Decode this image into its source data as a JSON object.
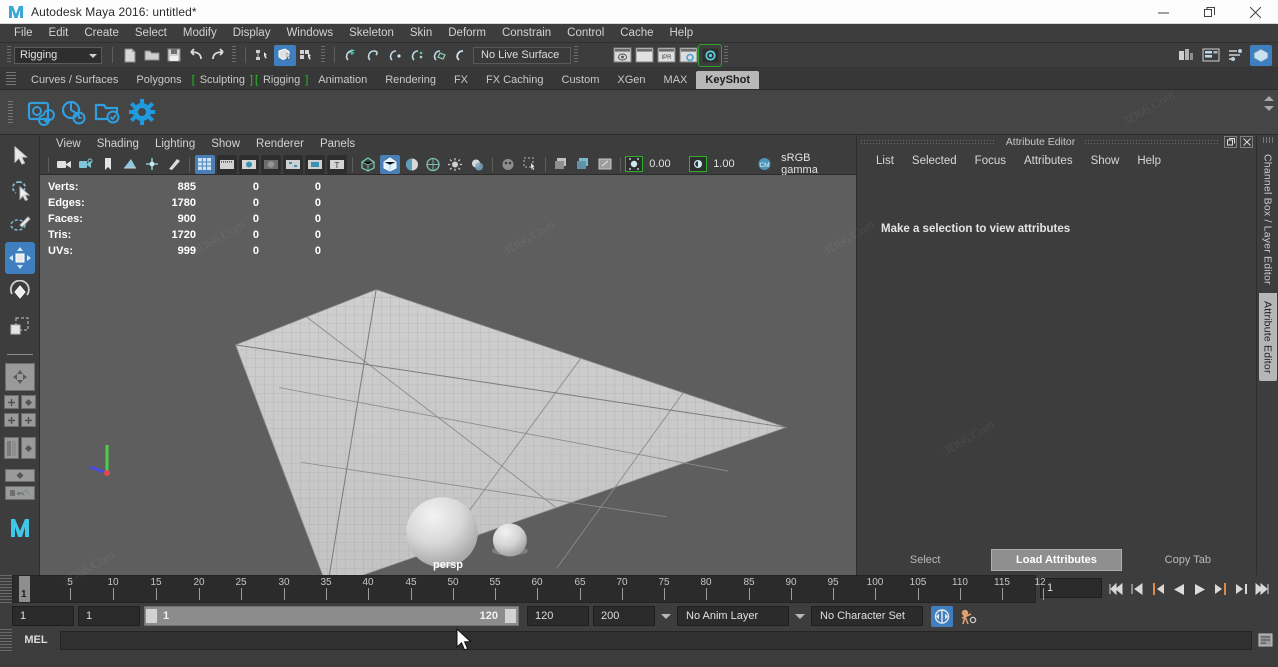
{
  "window": {
    "title": "Autodesk Maya 2016: untitled*",
    "app_icon": "maya-logo-icon",
    "minimize": "minimize-icon",
    "restore": "restore-icon",
    "close": "close-icon"
  },
  "menubar": {
    "items": [
      {
        "label": "File"
      },
      {
        "label": "Edit"
      },
      {
        "label": "Create"
      },
      {
        "label": "Select"
      },
      {
        "label": "Modify"
      },
      {
        "label": "Display"
      },
      {
        "label": "Windows"
      },
      {
        "label": "Skeleton"
      },
      {
        "label": "Skin"
      },
      {
        "label": "Deform"
      },
      {
        "label": "Constrain"
      },
      {
        "label": "Control"
      },
      {
        "label": "Cache"
      },
      {
        "label": "Help"
      }
    ]
  },
  "statusbar": {
    "menuset": "Rigging",
    "menuset_arrow": "chevron-down-icon",
    "live_surface": "No Live Surface",
    "file_icons": [
      "new-scene-icon",
      "open-scene-icon",
      "save-scene-icon",
      "undo-icon",
      "redo-icon"
    ],
    "selmask_icons": [
      "select-by-hierarchy-icon",
      "select-by-object-icon",
      "select-by-component-icon"
    ],
    "snap_icons": [
      "snap-to-grid-icon",
      "snap-to-curve-icon",
      "snap-to-point-icon",
      "snap-to-projected-center-icon",
      "snap-to-view-plane-icon",
      "make-live-icon"
    ],
    "render_icons": [
      "render-current-frame-icon",
      "ipr-render-icon",
      "render-settings-icon",
      "render-view-icon"
    ],
    "right_icons": [
      "show-hide-modeling-toolkit-icon",
      "show-hide-attribute-editor-icon",
      "show-hide-tool-settings-icon",
      "show-hide-channel-box-icon"
    ]
  },
  "shelf": {
    "tabs": [
      {
        "label": "Curves / Surfaces",
        "active": false,
        "bracket": false
      },
      {
        "label": "Polygons",
        "active": false,
        "bracket": false
      },
      {
        "label": "Sculpting",
        "active": false,
        "bracket": true
      },
      {
        "label": "Rigging",
        "active": false,
        "bracket": true
      },
      {
        "label": "Animation",
        "active": false,
        "bracket": false
      },
      {
        "label": "Rendering",
        "active": false,
        "bracket": false
      },
      {
        "label": "FX",
        "active": false,
        "bracket": false
      },
      {
        "label": "FX Caching",
        "active": false,
        "bracket": false
      },
      {
        "label": "Custom",
        "active": false,
        "bracket": false
      },
      {
        "label": "XGen",
        "active": false,
        "bracket": false
      },
      {
        "label": "MAX",
        "active": false,
        "bracket": false
      },
      {
        "label": "KeyShot",
        "active": true,
        "bracket": false
      }
    ],
    "icons": [
      "keyshot-render-icon",
      "keyshot-animation-icon",
      "keyshot-folder-icon",
      "keyshot-settings-icon"
    ],
    "scroll_up": "scroll-up-icon",
    "scroll_down": "scroll-down-icon"
  },
  "toolbox": {
    "tools": [
      {
        "name": "select-tool",
        "selected": false
      },
      {
        "name": "lasso-select-tool",
        "selected": false
      },
      {
        "name": "paint-select-tool",
        "selected": false
      },
      {
        "name": "move-tool",
        "selected": true
      },
      {
        "name": "rotate-tool",
        "selected": false
      },
      {
        "name": "scale-tool",
        "selected": false
      }
    ],
    "layouts": [
      {
        "name": "single-perspective-layout"
      },
      {
        "name": "four-view-layout"
      },
      {
        "name": "persp-outliner-layout"
      },
      {
        "name": "persp-graph-layout"
      }
    ]
  },
  "viewport": {
    "menus": [
      {
        "label": "View"
      },
      {
        "label": "Shading"
      },
      {
        "label": "Lighting"
      },
      {
        "label": "Show"
      },
      {
        "label": "Renderer"
      },
      {
        "label": "Panels"
      }
    ],
    "toolbar_icons": [
      "select-camera-icon",
      "camera-attributes-icon",
      "bookmark-icon",
      "image-plane-icon",
      "two-d-pan-zoom-icon",
      "grease-pencil-icon",
      "grid-toggle-icon",
      "film-gate-icon",
      "resolution-gate-icon",
      "gate-mask-icon",
      "film-origin-icon",
      "safe-action-icon",
      "safe-title-icon",
      "wireframe-icon",
      "smooth-shade-icon",
      "shaded-wireframe-icon",
      "textured-icon",
      "use-all-lights-icon",
      "shadows-icon",
      "screen-space-ao-icon",
      "motion-blur-icon",
      "multisample-icon",
      "xray-icon",
      "xray-joints-icon"
    ],
    "exposure_value": "0.00",
    "gamma_value": "1.00",
    "color_management": "sRGB gamma",
    "camera_label": "persp",
    "hud": {
      "columns": [
        "name",
        "total",
        "selected",
        "other"
      ],
      "rows": [
        {
          "label": "Verts:",
          "c1": "885",
          "c2": "0",
          "c3": "0"
        },
        {
          "label": "Edges:",
          "c1": "1780",
          "c2": "0",
          "c3": "0"
        },
        {
          "label": "Faces:",
          "c1": "900",
          "c2": "0",
          "c3": "0"
        },
        {
          "label": "Tris:",
          "c1": "1720",
          "c2": "0",
          "c3": "0"
        },
        {
          "label": "UVs:",
          "c1": "999",
          "c2": "0",
          "c3": "0"
        }
      ]
    },
    "axis_gizmo": "axis-orientation-gizmo"
  },
  "attribute_editor": {
    "title": "Attribute Editor",
    "float_button": "float-panel-icon",
    "close_button": "close-panel-icon",
    "menus": [
      {
        "label": "List"
      },
      {
        "label": "Selected"
      },
      {
        "label": "Focus"
      },
      {
        "label": "Attributes"
      },
      {
        "label": "Show"
      },
      {
        "label": "Help"
      }
    ],
    "empty_message": "Make a selection to view attributes",
    "footer": {
      "select": "Select",
      "load_attributes": "Load Attributes",
      "copy_tab": "Copy Tab"
    }
  },
  "side_tabs": [
    {
      "label": "Channel Box / Layer Editor",
      "selected": false
    },
    {
      "label": "Attribute Editor",
      "selected": true
    }
  ],
  "timeline": {
    "start": 1,
    "end": 120,
    "current_frame": "1",
    "tick_labels": [
      "5",
      "10",
      "15",
      "20",
      "25",
      "30",
      "35",
      "40",
      "45",
      "50",
      "55",
      "60",
      "65",
      "70",
      "75",
      "80",
      "85",
      "90",
      "95",
      "100",
      "105",
      "110",
      "115",
      "12"
    ],
    "playback_buttons": [
      "go-to-start-icon",
      "step-back-keyframe-icon",
      "step-back-frame-icon",
      "play-backwards-icon",
      "play-forwards-icon",
      "step-forward-frame-icon",
      "step-forward-keyframe-icon",
      "go-to-end-icon"
    ]
  },
  "range_slider": {
    "anim_start": "1",
    "range_start": "1",
    "slider_low": "1",
    "slider_high": "120",
    "range_end": "120",
    "anim_end": "200",
    "anim_layer": "No Anim Layer",
    "character_set": "No Character Set",
    "auto_keyframe_icon": "auto-keyframe-icon",
    "animation_prefs_icon": "animation-preferences-icon",
    "dropdown_icon": "chevron-down-icon"
  },
  "command_line": {
    "language": "MEL",
    "value": "",
    "script_editor_icon": "script-editor-icon"
  },
  "colors": {
    "accent_blue": "#3f7fbf",
    "shelf_active": "#b8b8b8",
    "viewport_bg": "#5e5e5e",
    "panel_bg": "#3d3d3d",
    "green_bracket": "#22c422"
  },
  "watermark": "3D66.Com"
}
